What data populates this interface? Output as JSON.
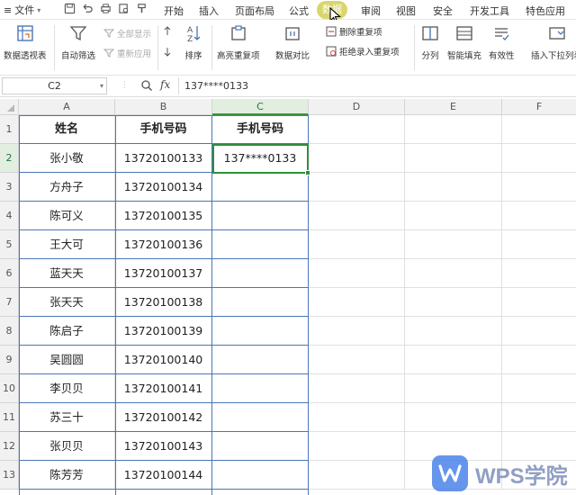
{
  "menubar": {
    "file_label": "文件",
    "tabs": [
      {
        "label": "开始"
      },
      {
        "label": "插入"
      },
      {
        "label": "页面布局"
      },
      {
        "label": "公式"
      },
      {
        "label": "数据",
        "active": true
      },
      {
        "label": "审阅"
      },
      {
        "label": "视图"
      },
      {
        "label": "安全"
      },
      {
        "label": "开发工具"
      },
      {
        "label": "特色应用"
      }
    ],
    "active_tab_color": "#d9d66b"
  },
  "ribbon": {
    "pivot_table": "数据透视表",
    "auto_filter": "自动筛选",
    "show_all": "全部显示",
    "reapply": "重新应用",
    "sort": "排序",
    "highlight_duplicates": "高亮重复项",
    "data_compare": "数据对比",
    "remove_duplicates": "删除重复项",
    "reject_duplicates": "拒绝录入重复项",
    "split_column": "分列",
    "smart_fill": "智能填充",
    "validity": "有效性",
    "insert_dropdown": "插入下拉列表"
  },
  "formula_bar": {
    "name_box": "C2",
    "fx_label": "fx",
    "content": "137****0133"
  },
  "grid": {
    "columns": [
      "A",
      "B",
      "C",
      "D",
      "E",
      "F"
    ],
    "selected_column": "C",
    "selected_row": "2",
    "header_row": [
      "姓名",
      "手机号码",
      "手机号码"
    ],
    "rows": [
      {
        "num": "2",
        "a": "张小敬",
        "b": "13720100133",
        "c": "137****0133"
      },
      {
        "num": "3",
        "a": "方舟子",
        "b": "13720100134",
        "c": ""
      },
      {
        "num": "4",
        "a": "陈可义",
        "b": "13720100135",
        "c": ""
      },
      {
        "num": "5",
        "a": "王大可",
        "b": "13720100136",
        "c": ""
      },
      {
        "num": "6",
        "a": "蓝天天",
        "b": "13720100137",
        "c": ""
      },
      {
        "num": "7",
        "a": "张天天",
        "b": "13720100138",
        "c": ""
      },
      {
        "num": "8",
        "a": "陈启子",
        "b": "13720100139",
        "c": ""
      },
      {
        "num": "9",
        "a": "吴圆圆",
        "b": "13720100140",
        "c": ""
      },
      {
        "num": "10",
        "a": "李贝贝",
        "b": "13720100141",
        "c": ""
      },
      {
        "num": "11",
        "a": "苏三十",
        "b": "13720100142",
        "c": ""
      },
      {
        "num": "12",
        "a": "张贝贝",
        "b": "13720100143",
        "c": ""
      },
      {
        "num": "13",
        "a": "陈芳芳",
        "b": "13720100144",
        "c": ""
      }
    ],
    "header_row_num": "1",
    "selection_color": "#2f8f3a",
    "border_color": "#4a76b7"
  },
  "watermark": {
    "text": "WPS学院"
  }
}
